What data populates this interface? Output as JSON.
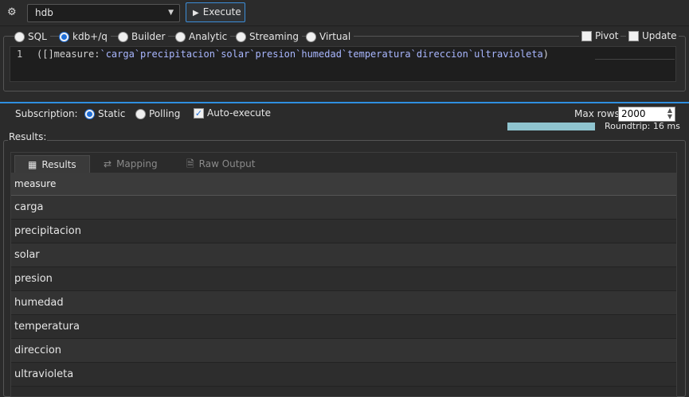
{
  "toolbar": {
    "connections_icon": "gears-icon",
    "database": "hdb",
    "execute_label": "Execute"
  },
  "query_modes": [
    {
      "label": "SQL",
      "selected": false
    },
    {
      "label": "kdb+/q",
      "selected": true
    },
    {
      "label": "Builder",
      "selected": false
    },
    {
      "label": "Analytic",
      "selected": false
    },
    {
      "label": "Streaming",
      "selected": false
    },
    {
      "label": "Virtual",
      "selected": false
    }
  ],
  "editor_options": {
    "pivot_label": "Pivot",
    "pivot_checked": false,
    "update_label": "Update",
    "update_checked": false
  },
  "editor": {
    "line_number": "1",
    "code_prefix": "([]measure:",
    "code_symbols": "`carga`precipitacion`solar`presion`humedad`temperatura`direccion`ultravioleta",
    "code_suffix": ")"
  },
  "subscription": {
    "label": "Subscription:",
    "static_label": "Static",
    "static_selected": true,
    "polling_label": "Polling",
    "polling_selected": false,
    "auto_execute_label": "Auto-execute",
    "auto_execute_checked": true,
    "max_rows_label": "Max rows:",
    "max_rows_value": "2000",
    "roundtrip": "Roundtrip: 16 ms"
  },
  "results": {
    "section_label": "Results:",
    "tabs": [
      {
        "label": "Results",
        "icon": "table-icon",
        "active": true
      },
      {
        "label": "Mapping",
        "icon": "mapping-icon",
        "active": false
      },
      {
        "label": "Raw Output",
        "icon": "document-icon",
        "active": false
      }
    ],
    "column": "measure",
    "rows": [
      "carga",
      "precipitacion",
      "solar",
      "presion",
      "humedad",
      "temperatura",
      "direccion",
      "ultravioleta"
    ]
  },
  "colors": {
    "accent": "#2f8fe0",
    "background": "#2b2b2b",
    "roundtrip_bar": "#8fc4cf"
  }
}
